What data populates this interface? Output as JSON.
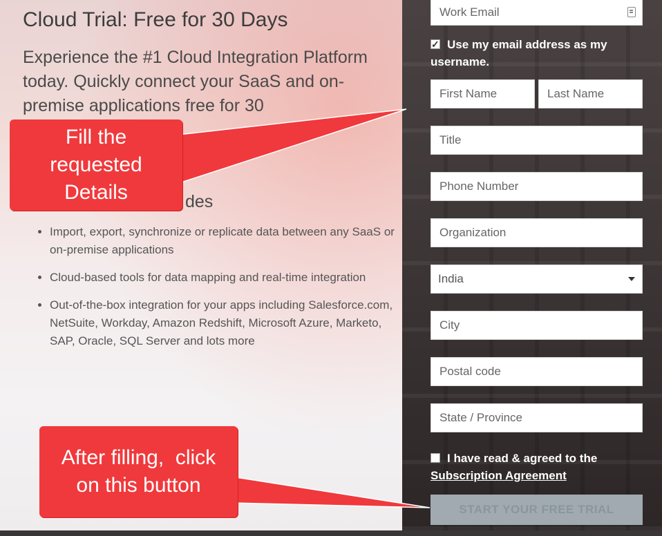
{
  "left": {
    "title": "Cloud Trial: Free for 30 Days",
    "intro": "Experience the #1 Cloud Integration Platform today. Quickly connect your SaaS and on-premise applications free for 30",
    "includes_tail": "des",
    "bullets": [
      "Import, export, synchronize or replicate data between any SaaS or on-premise applications",
      "Cloud-based tools for data mapping and real-time integration",
      "Out-of-the-box integration for your apps including Salesforce.com, NetSuite, Workday, Amazon Redshift, Microsoft Azure, Marketo, SAP, Oracle, SQL Server and lots more"
    ]
  },
  "form": {
    "work_email_placeholder": "Work Email",
    "use_email_label": "Use my email address as my username.",
    "use_email_checked": true,
    "first_name_placeholder": "First Name",
    "last_name_placeholder": "Last Name",
    "title_placeholder": "Title",
    "phone_placeholder": "Phone Number",
    "organization_placeholder": "Organization",
    "country_selected": "India",
    "city_placeholder": "City",
    "postal_placeholder": "Postal code",
    "state_placeholder": "State / Province",
    "agree_label": "I have read & agreed to the",
    "agree_link": "Subscription Agreement",
    "agree_checked": false,
    "submit_label": "START YOUR FREE TRIAL"
  },
  "annotations": {
    "callout_fill": "Fill the requested Details",
    "callout_fill_lines": [
      "Fill the",
      "requested",
      "Details"
    ],
    "callout_click_lines": [
      "After filling,  click",
      "on this button"
    ],
    "callout_color": "#f0393c"
  },
  "icons": {
    "email_field_icon": "contact-card-icon",
    "country_select_icon": "caret-down-icon"
  }
}
